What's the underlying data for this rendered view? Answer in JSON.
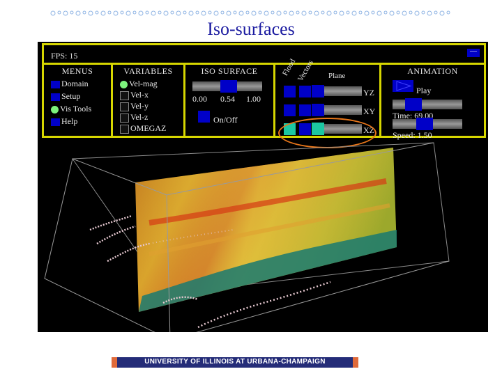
{
  "slide": {
    "title": "Iso-surfaces",
    "footer": "UNIVERSITY OF ILLINOIS AT URBANA-CHAMPAIGN"
  },
  "app": {
    "fps": "FPS: 15",
    "minimize": "—",
    "menus": {
      "title": "MENUS",
      "items": [
        "Domain",
        "Setup",
        "Vis Tools",
        "Help"
      ],
      "selected": "Vis Tools"
    },
    "variables": {
      "title": "VARIABLES",
      "items": [
        "Vel-mag",
        "Vel-x",
        "Vel-y",
        "Vel-z",
        "OMEGAZ"
      ],
      "selected": "Vel-mag"
    },
    "iso_surface": {
      "title": "ISO SURFACE",
      "min": "0.00",
      "value": "0.54",
      "max": "1.00",
      "toggle_label": "On/Off"
    },
    "planes": {
      "col_flood": "Flood",
      "col_vectors": "Vectors",
      "col_plane": "Plane",
      "rows": [
        {
          "label": "YZ"
        },
        {
          "label": "XY"
        },
        {
          "label": "XZ"
        }
      ]
    },
    "animation": {
      "title": "ANIMATION",
      "play": "Play",
      "time": "Time: 69.00",
      "speed": "Speed: 1.50"
    }
  },
  "colors": {
    "panel": "#d6d600",
    "button": "#0000c8",
    "active": "#1cc7a2",
    "highlight": "#e8761a",
    "title": "#1a1aa0"
  }
}
